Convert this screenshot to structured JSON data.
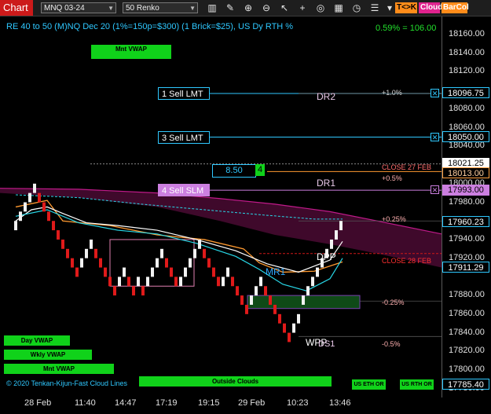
{
  "toolbar": {
    "title": "Chart",
    "instrument": "MNQ 03-24",
    "interval": "50 Renko",
    "icons": [
      "bar-style-icon",
      "pencil-icon",
      "zoom-in-icon",
      "zoom-out-icon",
      "cursor-icon",
      "plus-icon",
      "target-icon",
      "grid-icon",
      "clock-icon",
      "list-icon"
    ],
    "tags": [
      {
        "label": "T<>K",
        "bg": "#ff8c1a",
        "color": "#000000"
      },
      {
        "label": "Cloud",
        "bg": "#e0238e",
        "color": "#ffffff"
      },
      {
        "label": "BarCol",
        "bg": "#ff8c1a",
        "color": "#ffffff"
      }
    ]
  },
  "chart": {
    "header": "RE 40 to 50 (M)NQ Dec 20 (1%=150p=$300) (1 Brick=$25), US Dy RTH %",
    "pct_readout": "0.59% = 106.00",
    "mnt_vwap_top": "Mnt VWAP",
    "left_buttons": [
      "Day VWAP",
      "Wkly VWAP",
      "Mnt VWAP"
    ],
    "legend": "© 2020 Tenkan-Kijun-Fast Cloud Lines",
    "outside_clouds": "Outside Clouds",
    "eth_btn": "US ETH OR",
    "rth_btn": "US RTH OR",
    "qty_value": "8.50",
    "qty_count": "4",
    "annotations": {
      "dr2": "DR2",
      "dr1": "DR1",
      "dpp": "DPP",
      "mr1": "MR1",
      "wpp": "WPP",
      "ds1": "DS1",
      "pct_up1": "+1.0%",
      "pct_up05": "+0.5%",
      "pct_up025": "+0.25%",
      "pct_dn025": "-0.25%",
      "pct_dn05": "-0.5%",
      "close_27": "CLOSE 27 FEB",
      "close_28": "CLOSE 28 FEB"
    }
  },
  "orders": [
    {
      "label": "1 Sell LMT",
      "price": "18096.75",
      "color": "#2fc8ff"
    },
    {
      "label": "3 Sell LMT",
      "price": "18050.00",
      "color": "#2fc8ff"
    },
    {
      "label": "4 Sell SLM",
      "price": "17993.00",
      "color": "#cc7fe0"
    }
  ],
  "price_axis": {
    "ticks": [
      "18160.00",
      "18140.00",
      "18120.00",
      "18080.00",
      "18060.00",
      "18040.00",
      "18000.00",
      "17980.00",
      "17940.00",
      "17920.00",
      "17880.00",
      "17860.00",
      "17840.00",
      "17820.00",
      "17800.00",
      "17780.00"
    ],
    "current": "18021.25",
    "close_27_price": "18013.00",
    "level_17960": "17960.23",
    "level_17911": "17911.29",
    "level_bottom": "17785.40"
  },
  "time_axis": [
    "28 Feb",
    "11:40",
    "14:47",
    "17:19",
    "19:15",
    "29 Feb",
    "10:23",
    "13:46"
  ],
  "chart_data": {
    "type": "renko",
    "brick_size": 10,
    "ylim": [
      17780,
      18170
    ],
    "bricks": [
      {
        "x": 20,
        "o": 17950,
        "c": 17960
      },
      {
        "x": 26,
        "o": 17960,
        "c": 17970
      },
      {
        "x": 32,
        "o": 17970,
        "c": 17980
      },
      {
        "x": 38,
        "o": 17980,
        "c": 17990
      },
      {
        "x": 44,
        "o": 17990,
        "c": 18000
      },
      {
        "x": 50,
        "o": 17990,
        "c": 17980
      },
      {
        "x": 56,
        "o": 17980,
        "c": 17970
      },
      {
        "x": 62,
        "o": 17970,
        "c": 17960
      },
      {
        "x": 68,
        "o": 17960,
        "c": 17950
      },
      {
        "x": 74,
        "o": 17950,
        "c": 17940
      },
      {
        "x": 80,
        "o": 17940,
        "c": 17930
      },
      {
        "x": 86,
        "o": 17930,
        "c": 17920
      },
      {
        "x": 92,
        "o": 17920,
        "c": 17910
      },
      {
        "x": 98,
        "o": 17910,
        "c": 17900
      },
      {
        "x": 104,
        "o": 17910,
        "c": 17920
      },
      {
        "x": 110,
        "o": 17920,
        "c": 17930
      },
      {
        "x": 116,
        "o": 17930,
        "c": 17940
      },
      {
        "x": 122,
        "o": 17930,
        "c": 17920
      },
      {
        "x": 128,
        "o": 17920,
        "c": 17910
      },
      {
        "x": 134,
        "o": 17910,
        "c": 17900
      },
      {
        "x": 140,
        "o": 17900,
        "c": 17890
      },
      {
        "x": 146,
        "o": 17890,
        "c": 17880
      },
      {
        "x": 152,
        "o": 17890,
        "c": 17900
      },
      {
        "x": 158,
        "o": 17900,
        "c": 17910
      },
      {
        "x": 164,
        "o": 17900,
        "c": 17890
      },
      {
        "x": 170,
        "o": 17890,
        "c": 17880
      },
      {
        "x": 176,
        "o": 17890,
        "c": 17900
      },
      {
        "x": 182,
        "o": 17890,
        "c": 17880
      },
      {
        "x": 188,
        "o": 17890,
        "c": 17900
      },
      {
        "x": 194,
        "o": 17900,
        "c": 17910
      },
      {
        "x": 200,
        "o": 17910,
        "c": 17920
      },
      {
        "x": 206,
        "o": 17920,
        "c": 17930
      },
      {
        "x": 212,
        "o": 17920,
        "c": 17910
      },
      {
        "x": 218,
        "o": 17910,
        "c": 17900
      },
      {
        "x": 224,
        "o": 17900,
        "c": 17890
      },
      {
        "x": 230,
        "o": 17890,
        "c": 17900
      },
      {
        "x": 236,
        "o": 17900,
        "c": 17910
      },
      {
        "x": 242,
        "o": 17910,
        "c": 17920
      },
      {
        "x": 248,
        "o": 17920,
        "c": 17930
      },
      {
        "x": 254,
        "o": 17930,
        "c": 17940
      },
      {
        "x": 260,
        "o": 17930,
        "c": 17920
      },
      {
        "x": 266,
        "o": 17920,
        "c": 17910
      },
      {
        "x": 272,
        "o": 17910,
        "c": 17900
      },
      {
        "x": 278,
        "o": 17900,
        "c": 17890
      },
      {
        "x": 284,
        "o": 17890,
        "c": 17900
      },
      {
        "x": 290,
        "o": 17900,
        "c": 17910
      },
      {
        "x": 296,
        "o": 17900,
        "c": 17890
      },
      {
        "x": 302,
        "o": 17890,
        "c": 17880
      },
      {
        "x": 308,
        "o": 17880,
        "c": 17870
      },
      {
        "x": 314,
        "o": 17870,
        "c": 17860
      },
      {
        "x": 320,
        "o": 17870,
        "c": 17880
      },
      {
        "x": 326,
        "o": 17880,
        "c": 17890
      },
      {
        "x": 332,
        "o": 17890,
        "c": 17900
      },
      {
        "x": 338,
        "o": 17890,
        "c": 17880
      },
      {
        "x": 344,
        "o": 17880,
        "c": 17870
      },
      {
        "x": 350,
        "o": 17870,
        "c": 17860
      },
      {
        "x": 356,
        "o": 17860,
        "c": 17850
      },
      {
        "x": 362,
        "o": 17850,
        "c": 17840
      },
      {
        "x": 368,
        "o": 17840,
        "c": 17830
      },
      {
        "x": 374,
        "o": 17840,
        "c": 17850
      },
      {
        "x": 380,
        "o": 17850,
        "c": 17860
      },
      {
        "x": 386,
        "o": 17870,
        "c": 17880
      },
      {
        "x": 392,
        "o": 17880,
        "c": 17890
      },
      {
        "x": 398,
        "o": 17890,
        "c": 17900
      },
      {
        "x": 404,
        "o": 17900,
        "c": 17910
      },
      {
        "x": 410,
        "o": 17910,
        "c": 17920
      },
      {
        "x": 416,
        "o": 17920,
        "c": 17930
      },
      {
        "x": 422,
        "o": 17930,
        "c": 17940
      },
      {
        "x": 428,
        "o": 17940,
        "c": 17950
      },
      {
        "x": 434,
        "o": 17950,
        "c": 17960
      }
    ],
    "ma_white": [
      [
        20,
        17960
      ],
      [
        40,
        17972
      ],
      [
        60,
        17975
      ],
      [
        80,
        17968
      ],
      [
        110,
        17958
      ],
      [
        150,
        17955
      ],
      [
        200,
        17950
      ],
      [
        250,
        17940
      ],
      [
        300,
        17928
      ],
      [
        340,
        17914
      ],
      [
        380,
        17905
      ],
      [
        420,
        17918
      ],
      [
        436,
        17938
      ]
    ],
    "ma_cyan": [
      [
        20,
        17965
      ],
      [
        60,
        17972
      ],
      [
        100,
        17958
      ],
      [
        150,
        17950
      ],
      [
        200,
        17946
      ],
      [
        250,
        17936
      ],
      [
        300,
        17922
      ],
      [
        330,
        17908
      ],
      [
        360,
        17892
      ],
      [
        390,
        17885
      ],
      [
        420,
        17898
      ],
      [
        436,
        17920
      ]
    ],
    "ma_orange": [
      [
        20,
        17975
      ],
      [
        60,
        17982
      ],
      [
        80,
        17960
      ],
      [
        140,
        17955
      ],
      [
        200,
        17945
      ],
      [
        260,
        17940
      ],
      [
        310,
        17930
      ],
      [
        330,
        17915
      ],
      [
        360,
        17905
      ],
      [
        400,
        17906
      ],
      [
        436,
        17916
      ]
    ],
    "dashed_cyan": [
      [
        20,
        17988
      ],
      [
        100,
        17985
      ],
      [
        180,
        17978
      ],
      [
        260,
        17972
      ],
      [
        340,
        17966
      ],
      [
        400,
        17962
      ],
      [
        436,
        17962
      ]
    ],
    "cloud_upper": [
      [
        0,
        17995
      ],
      [
        100,
        17994
      ],
      [
        200,
        17990
      ],
      [
        280,
        17984
      ],
      [
        350,
        17978
      ],
      [
        420,
        17970
      ],
      [
        480,
        17960
      ],
      [
        562,
        17946
      ]
    ],
    "cloud_lower": [
      [
        0,
        17990
      ],
      [
        100,
        17985
      ],
      [
        200,
        17975
      ],
      [
        280,
        17960
      ],
      [
        350,
        17945
      ],
      [
        420,
        17935
      ],
      [
        480,
        17925
      ],
      [
        562,
        17910
      ]
    ]
  }
}
